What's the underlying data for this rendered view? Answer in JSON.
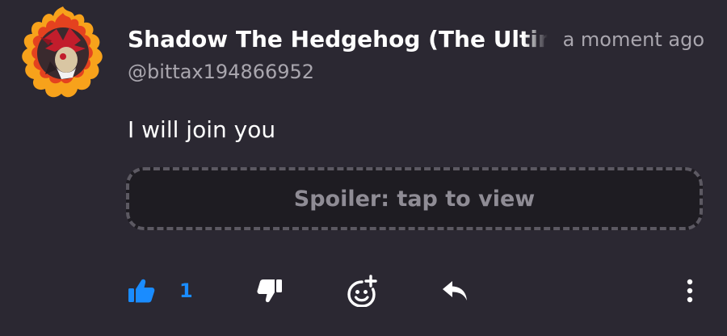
{
  "post": {
    "display_name": "Shadow The Hedgehog (The Ultimate Lifeform)",
    "timestamp": "a moment ago",
    "handle": "@bittax194866952",
    "body": "I will join you",
    "spoiler_label": "Spoiler: tap to view"
  },
  "actions": {
    "like_count": "1",
    "like_icon": "thumbs-up-icon",
    "dislike_icon": "thumbs-down-icon",
    "react_icon": "add-reaction-icon",
    "reply_icon": "reply-icon",
    "more_icon": "more-vertical-icon"
  },
  "colors": {
    "background": "#2b2832",
    "accent": "#1a8cff",
    "muted_text": "#a9a6ae",
    "spoiler_bg": "#1e1c22",
    "spoiler_border": "#5c5962"
  }
}
